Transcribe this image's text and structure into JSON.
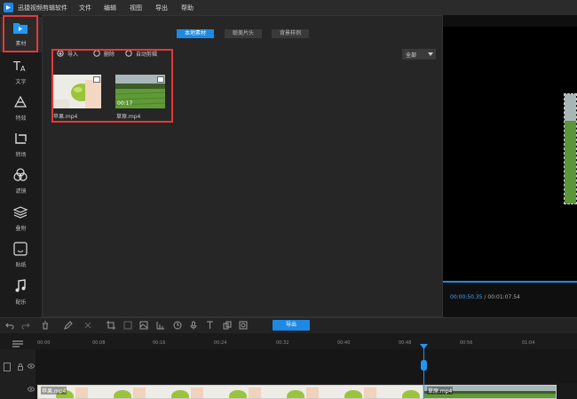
{
  "app": {
    "title": "迅捷视频剪辑软件"
  },
  "menu": [
    "文件",
    "编辑",
    "视图",
    "导出",
    "帮助"
  ],
  "sidebar": {
    "items": [
      {
        "label": "素材",
        "icon": "folder-icon",
        "active": true
      },
      {
        "label": "文字",
        "icon": "text-icon"
      },
      {
        "label": "特效",
        "icon": "effects-icon"
      },
      {
        "label": "转场",
        "icon": "transition-icon"
      },
      {
        "label": "滤镜",
        "icon": "filter-icon"
      },
      {
        "label": "叠附",
        "icon": "overlay-icon"
      },
      {
        "label": "贴纸",
        "icon": "sticker-icon"
      },
      {
        "label": "配乐",
        "icon": "music-icon"
      }
    ]
  },
  "panel": {
    "tabs": [
      {
        "label": "本地素材",
        "active": true
      },
      {
        "label": "聪美片头"
      },
      {
        "label": "背景样例"
      }
    ],
    "actions": [
      "导入",
      "删除",
      "自动剪辑"
    ],
    "filter": "全部",
    "media": [
      {
        "name": "苹果.mp4",
        "duration": "",
        "theme": "apple"
      },
      {
        "name": "草原.mp4",
        "duration": "00:17",
        "theme": "grass"
      }
    ]
  },
  "preview": {
    "current_time": "00:00:50.35",
    "separator": "/",
    "total_time": "00:01:07.54"
  },
  "toolbar": {
    "export_label": "导出"
  },
  "timeline": {
    "ticks": [
      "00:00",
      "00:08",
      "00:16",
      "00:24",
      "00:32",
      "00:40",
      "00:48",
      "00:56",
      "01:04"
    ],
    "clips": [
      {
        "name": "苹果.mp4"
      },
      {
        "name": "草原.mp4"
      }
    ]
  },
  "colors": {
    "accent": "#1e88e5",
    "highlight": "#e53935"
  }
}
